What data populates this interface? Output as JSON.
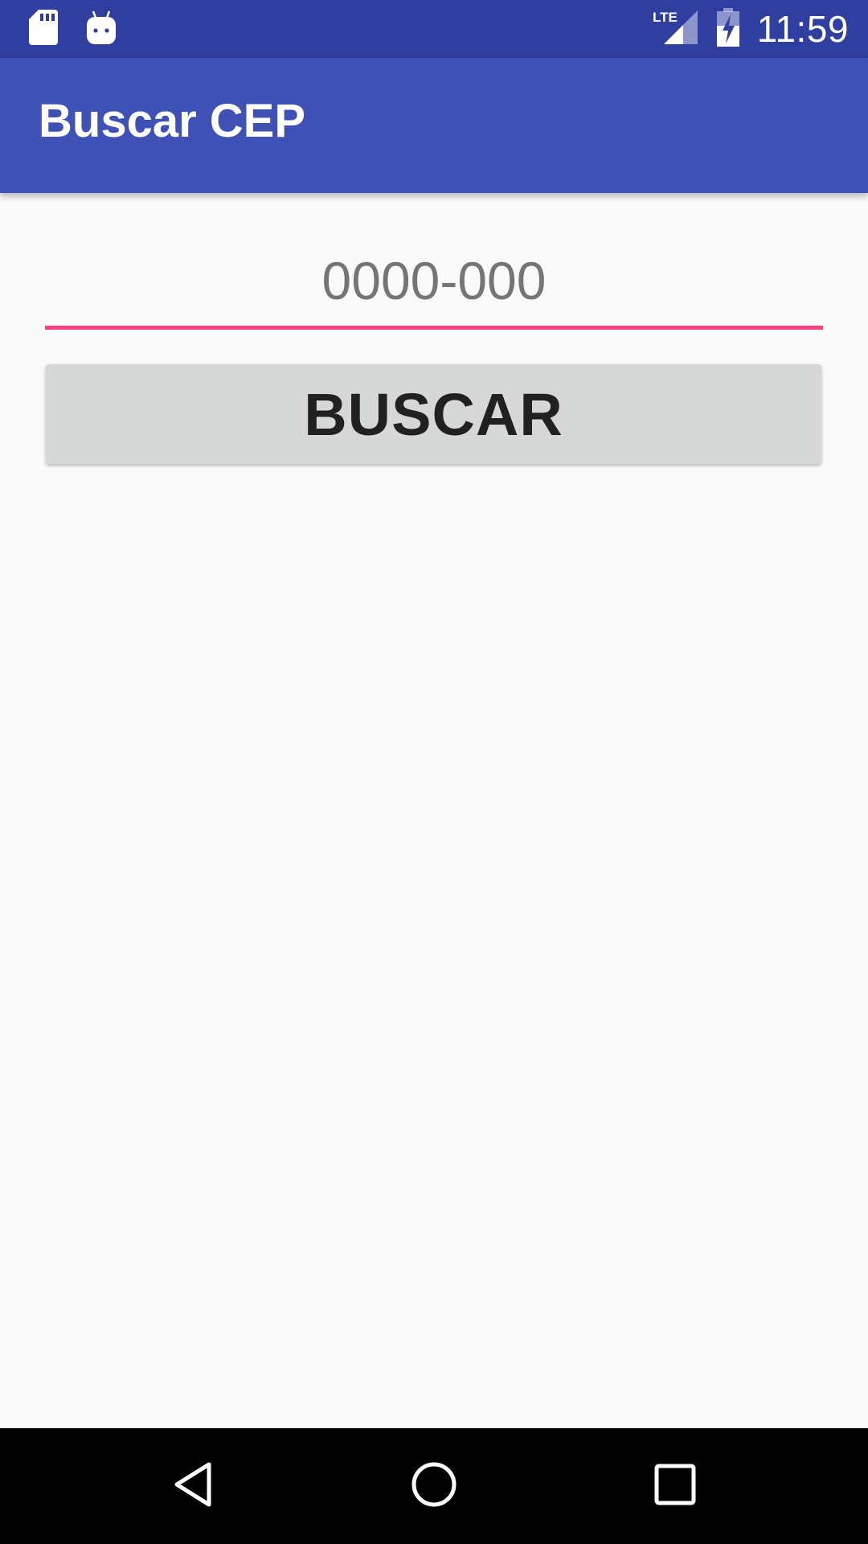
{
  "status_bar": {
    "time": "11:59",
    "network_label": "LTE",
    "icons": [
      "sd-card-icon",
      "android-icon",
      "lte-signal-icon",
      "battery-charging-icon"
    ]
  },
  "app_bar": {
    "title": "Buscar CEP"
  },
  "cep_input": {
    "value": "",
    "placeholder": "0000-000"
  },
  "search_button": {
    "label": "BUSCAR"
  },
  "nav_bar": {
    "icons": [
      "back-icon",
      "home-icon",
      "recents-icon"
    ]
  },
  "colors": {
    "status_bar": "#303f9f",
    "app_bar": "#3f51b5",
    "accent": "#ff4081",
    "background": "#fafafa",
    "button": "#d6d7d7"
  }
}
